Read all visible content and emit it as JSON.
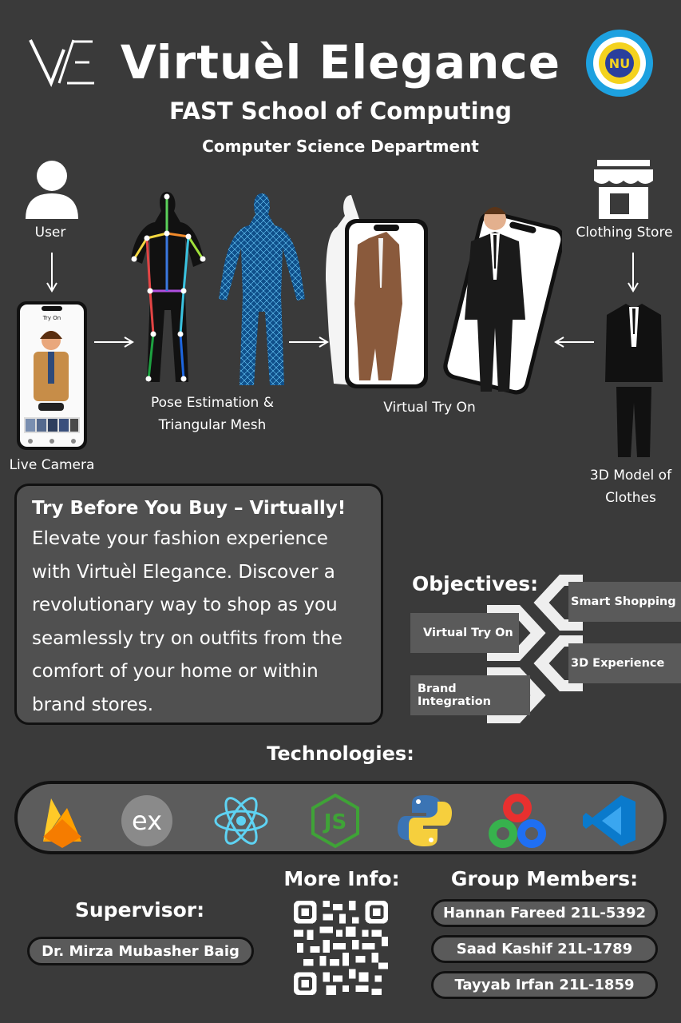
{
  "header": {
    "logo_text": "VE",
    "title": "Virtuèl Elegance",
    "subtitle": "FAST School of Computing",
    "department": "Computer Science Department",
    "seal_icon": "university-seal-icon"
  },
  "flow": {
    "user": "User",
    "clothing_store": "Clothing Store",
    "live_camera": "Live Camera",
    "pose_line1": "Pose Estimation &",
    "pose_line2": "Triangular Mesh",
    "virtual_try_on": "Virtual Try On",
    "model_line1": "3D Model of",
    "model_line2": "Clothes",
    "phone_screen_title": "Try On"
  },
  "description": {
    "heading": "Try Before You Buy – Virtually!",
    "body": "Elevate your fashion experience with Virtuèl Elegance. Discover a revolutionary way to shop as you seamlessly try on outfits from the comfort of your home or within brand stores."
  },
  "objectives": {
    "title": "Objectives:",
    "items": [
      "Smart Shopping",
      "Virtual Try On",
      "3D Experience",
      "Brand Integration"
    ]
  },
  "technologies": {
    "title": "Technologies:",
    "icons": [
      "firebase-icon",
      "express-icon",
      "react-icon",
      "nodejs-icon",
      "python-icon",
      "opencv-icon",
      "vscode-icon"
    ]
  },
  "supervisor": {
    "title": "Supervisor:",
    "name": "Dr. Mirza Mubasher Baig"
  },
  "more_info": {
    "title": "More Info:"
  },
  "group": {
    "title": "Group Members:",
    "members": [
      "Hannan Fareed 21L-5392",
      "Saad Kashif 21L-1789",
      "Tayyab Irfan 21L-1859"
    ]
  },
  "colors": {
    "background": "#3a3a3a",
    "panel": "#505050",
    "pill": "#5c5c5c",
    "outline": "#111111"
  }
}
